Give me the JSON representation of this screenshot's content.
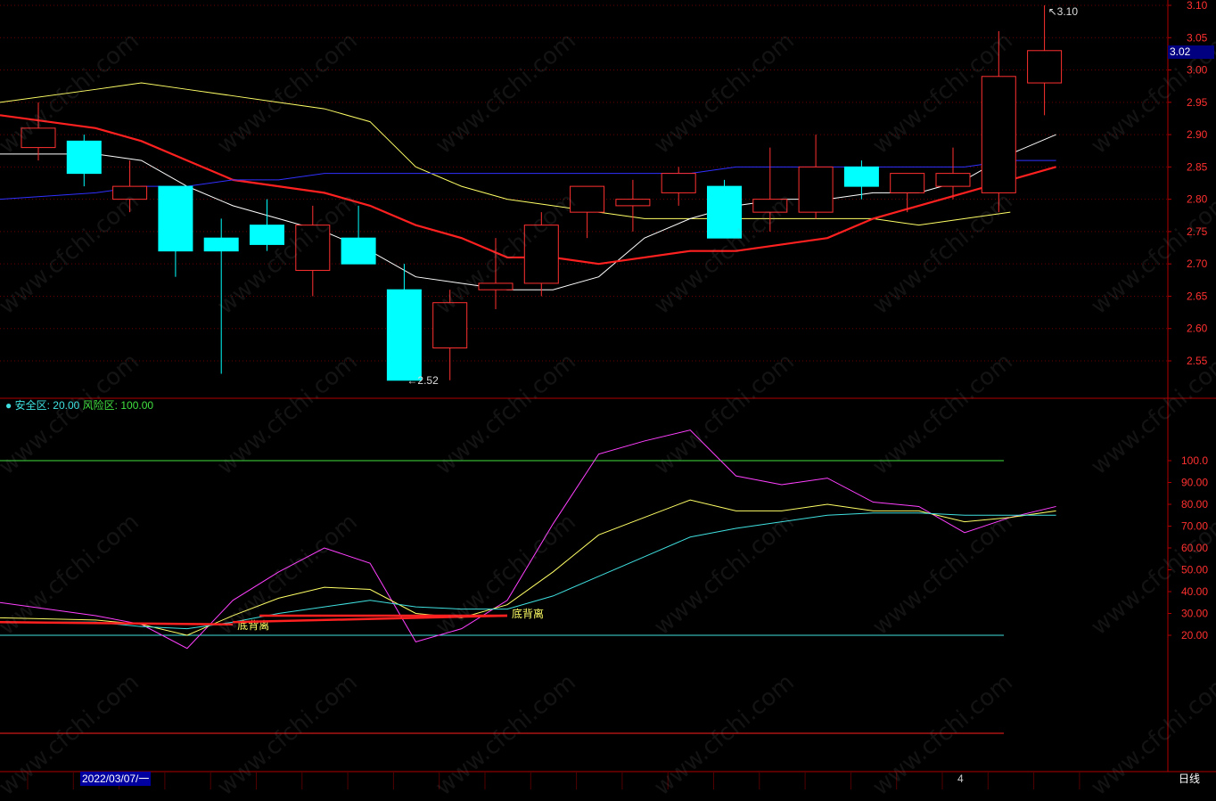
{
  "chart_data": [
    {
      "type": "candlestick",
      "ylim": [
        2.5,
        3.12
      ],
      "y_ticks": [
        "3.10",
        "3.05",
        "3.00",
        "2.95",
        "2.90",
        "2.85",
        "2.80",
        "2.75",
        "2.70",
        "2.65",
        "2.60",
        "2.55"
      ],
      "tick_values": [
        3.1,
        3.05,
        3.0,
        2.95,
        2.9,
        2.85,
        2.8,
        2.75,
        2.7,
        2.65,
        2.6,
        2.55
      ],
      "last_price": "3.02",
      "high_marker": "3.10",
      "low_marker": "2.52",
      "candles": [
        {
          "o": 2.88,
          "h": 2.95,
          "l": 2.86,
          "c": 2.91
        },
        {
          "o": 2.89,
          "h": 2.9,
          "l": 2.82,
          "c": 2.84
        },
        {
          "o": 2.8,
          "h": 2.86,
          "l": 2.78,
          "c": 2.82
        },
        {
          "o": 2.82,
          "h": 2.82,
          "l": 2.68,
          "c": 2.72
        },
        {
          "o": 2.74,
          "h": 2.77,
          "l": 2.53,
          "c": 2.72
        },
        {
          "o": 2.76,
          "h": 2.8,
          "l": 2.72,
          "c": 2.73
        },
        {
          "o": 2.69,
          "h": 2.79,
          "l": 2.65,
          "c": 2.76
        },
        {
          "o": 2.74,
          "h": 2.79,
          "l": 2.7,
          "c": 2.7
        },
        {
          "o": 2.66,
          "h": 2.7,
          "l": 2.52,
          "c": 2.52
        },
        {
          "o": 2.57,
          "h": 2.66,
          "l": 2.52,
          "c": 2.64
        },
        {
          "o": 2.66,
          "h": 2.74,
          "l": 2.63,
          "c": 2.67
        },
        {
          "o": 2.67,
          "h": 2.78,
          "l": 2.65,
          "c": 2.76
        },
        {
          "o": 2.78,
          "h": 2.82,
          "l": 2.74,
          "c": 2.82
        },
        {
          "o": 2.79,
          "h": 2.83,
          "l": 2.75,
          "c": 2.8
        },
        {
          "o": 2.81,
          "h": 2.85,
          "l": 2.79,
          "c": 2.84
        },
        {
          "o": 2.82,
          "h": 2.83,
          "l": 2.74,
          "c": 2.74
        },
        {
          "o": 2.78,
          "h": 2.88,
          "l": 2.75,
          "c": 2.8
        },
        {
          "o": 2.78,
          "h": 2.9,
          "l": 2.77,
          "c": 2.85
        },
        {
          "o": 2.85,
          "h": 2.86,
          "l": 2.8,
          "c": 2.82
        },
        {
          "o": 2.81,
          "h": 2.84,
          "l": 2.78,
          "c": 2.84
        },
        {
          "o": 2.82,
          "h": 2.88,
          "l": 2.8,
          "c": 2.84
        },
        {
          "o": 2.81,
          "h": 3.06,
          "l": 2.78,
          "c": 2.99
        },
        {
          "o": 2.98,
          "h": 3.1,
          "l": 2.93,
          "c": 3.03
        }
      ],
      "ma_series": [
        {
          "color": "#ffff66",
          "values": [
            2.95,
            2.97,
            2.98,
            2.97,
            2.96,
            2.95,
            2.94,
            2.92,
            2.85,
            2.82,
            2.8,
            2.79,
            2.78,
            2.77,
            2.77,
            2.77,
            2.77,
            2.77,
            2.77,
            2.76,
            2.77,
            2.78
          ]
        },
        {
          "color": "#ffffff",
          "values": [
            2.87,
            2.87,
            2.86,
            2.82,
            2.79,
            2.77,
            2.75,
            2.72,
            2.68,
            2.67,
            2.66,
            2.66,
            2.68,
            2.74,
            2.77,
            2.79,
            2.8,
            2.8,
            2.81,
            2.81,
            2.83,
            2.87,
            2.9
          ]
        },
        {
          "color": "#ff2020",
          "values": [
            2.93,
            2.91,
            2.89,
            2.86,
            2.83,
            2.82,
            2.81,
            2.79,
            2.76,
            2.74,
            2.71,
            2.71,
            2.7,
            2.71,
            2.72,
            2.72,
            2.73,
            2.74,
            2.77,
            2.79,
            2.81,
            2.83,
            2.85
          ]
        },
        {
          "color": "#3030ff",
          "values": [
            2.8,
            2.81,
            2.82,
            2.82,
            2.83,
            2.83,
            2.84,
            2.84,
            2.84,
            2.84,
            2.84,
            2.84,
            2.84,
            2.84,
            2.84,
            2.85,
            2.85,
            2.85,
            2.85,
            2.85,
            2.85,
            2.86,
            2.86
          ]
        }
      ]
    },
    {
      "type": "line",
      "ylim": [
        0,
        120
      ],
      "y_ticks": [
        "100.0",
        "90.00",
        "80.00",
        "70.00",
        "60.00",
        "50.00",
        "40.00",
        "30.00",
        "20.00"
      ],
      "tick_values": [
        100,
        90,
        80,
        70,
        60,
        50,
        40,
        30,
        20
      ],
      "safe_zone_label": "安全区:",
      "safe_zone_value": "20.00",
      "risk_zone_label": "风险区:",
      "risk_zone_value": "100.00",
      "safe_level": 20,
      "risk_level": 100,
      "bottom_level": 0,
      "series": [
        {
          "color": "#ff40ff",
          "values": [
            35,
            29,
            25,
            14,
            36,
            49,
            60,
            53,
            17,
            23,
            36,
            71,
            103,
            109,
            114,
            93,
            89,
            92,
            81,
            79,
            67,
            74,
            79
          ]
        },
        {
          "color": "#ffff66",
          "values": [
            28,
            27,
            25,
            20,
            29,
            37,
            42,
            41,
            30,
            28,
            34,
            49,
            66,
            74,
            82,
            77,
            77,
            80,
            77,
            77,
            72,
            74,
            77
          ]
        },
        {
          "color": "#40e0e0",
          "values": [
            26,
            26,
            24,
            23,
            26,
            30,
            33,
            36,
            33,
            32,
            32,
            38,
            47,
            56,
            65,
            69,
            72,
            75,
            76,
            76,
            75,
            75,
            75
          ]
        }
      ],
      "divergence_lines": [
        {
          "label": "底背离",
          "from": 0,
          "to": 4,
          "y_from": 26,
          "y_to": 25,
          "label_at": 4
        },
        {
          "label": "底背离",
          "from": 4,
          "to": 10,
          "y_from": 26,
          "y_to": 29,
          "label_at": 10
        }
      ],
      "secondary_divergence": {
        "from": 4,
        "to": 10,
        "y_from": 29,
        "y_to": 29
      }
    }
  ],
  "footer": {
    "date": "2022/03/07/一",
    "bar_index": "4",
    "period_tab": "日线"
  },
  "watermark": "www.cfchi.com"
}
